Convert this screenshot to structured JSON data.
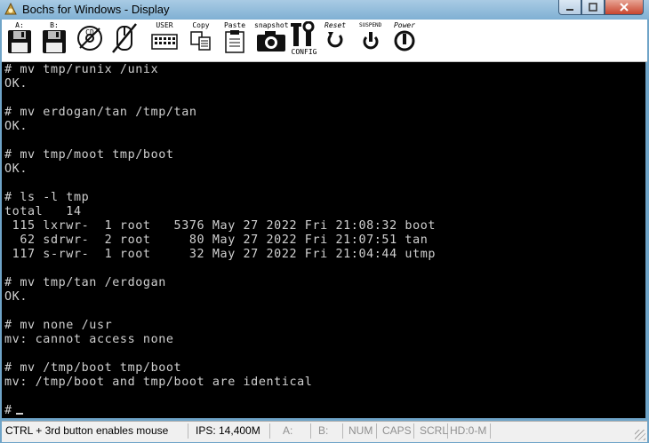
{
  "window": {
    "title": "Bochs for Windows - Display"
  },
  "toolbar": {
    "buttons": [
      {
        "id": "floppy-a",
        "label": "A:",
        "icon": "floppy-icon"
      },
      {
        "id": "floppy-b",
        "label": "B:",
        "icon": "floppy-icon"
      },
      {
        "id": "cdrom",
        "label": "CD",
        "icon": "cdrom-icon"
      },
      {
        "id": "mouse",
        "label": "",
        "icon": "mouse-disabled-icon"
      },
      {
        "id": "user",
        "label": "USER",
        "icon": "keyboard-icon"
      },
      {
        "id": "copy",
        "label": "Copy",
        "icon": "copy-icon"
      },
      {
        "id": "paste",
        "label": "Paste",
        "icon": "paste-icon"
      },
      {
        "id": "snapshot",
        "label": "snapshot",
        "icon": "camera-icon"
      },
      {
        "id": "config",
        "label": "CONFIG",
        "icon": "config-icon"
      },
      {
        "id": "reset",
        "label": "Reset",
        "icon": "reset-icon"
      },
      {
        "id": "suspend",
        "label": "SUSPEND",
        "icon": "suspend-icon"
      },
      {
        "id": "power",
        "label": "Power",
        "icon": "power-icon"
      }
    ]
  },
  "console": {
    "lines": [
      "# mv tmp/runix /unix",
      "OK.",
      "",
      "# mv erdogan/tan /tmp/tan",
      "OK.",
      "",
      "# mv tmp/moot tmp/boot",
      "OK.",
      "",
      "# ls -l tmp",
      "total   14",
      " 115 lxrwr-  1 root   5376 May 27 2022 Fri 21:08:32 boot",
      "  62 sdrwr-  2 root     80 May 27 2022 Fri 21:07:51 tan",
      " 117 s-rwr-  1 root     32 May 27 2022 Fri 21:04:44 utmp",
      "",
      "# mv tmp/tan /erdogan",
      "OK.",
      "",
      "# mv none /usr",
      "mv: cannot access none",
      "",
      "# mv /tmp/boot tmp/boot",
      "mv: /tmp/boot and tmp/boot are identical",
      "",
      "#"
    ]
  },
  "statusbar": {
    "hint": "CTRL + 3rd button enables mouse",
    "ips": "IPS: 14,400M",
    "a": "A:",
    "b": "B:",
    "num": "NUM",
    "caps": "CAPS",
    "scrl": "SCRL",
    "hd": "HD:0-M"
  }
}
